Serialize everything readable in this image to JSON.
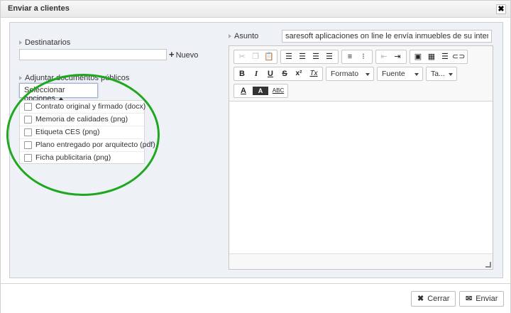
{
  "dialog": {
    "title": "Enviar a clientes",
    "close_glyph": "✖"
  },
  "recipients": {
    "label": "Destinatarios",
    "value": "",
    "new_icon": "+",
    "new_label": "Nuevo"
  },
  "attach": {
    "label": "Adjuntar documentos públicos",
    "select_label": "Seleccionar opciones",
    "options": [
      {
        "label": "Contrato original y firmado (docx)",
        "checked": false
      },
      {
        "label": "Memoria de calidades (png)",
        "checked": false
      },
      {
        "label": "Etiqueta CES (png)",
        "checked": false
      },
      {
        "label": "Plano entregado por arquitecto (pdf)",
        "checked": false
      },
      {
        "label": "Ficha publicitaria (png)",
        "checked": false
      }
    ]
  },
  "subject": {
    "label": "Asunto",
    "value": "saresoft aplicaciones on line le envía inmuebles de su interés"
  },
  "editor": {
    "format_label": "Formato",
    "font_label": "Fuente",
    "size_label": "Ta...",
    "bold": "B",
    "italic": "I",
    "underline": "U",
    "strike": "S",
    "superscript": "x²",
    "clear": "Tx",
    "text_color": "A",
    "bg_color": "A",
    "spellcheck": "ABC"
  },
  "footer": {
    "cancel_icon": "✖",
    "cancel_label": "Cerrar",
    "send_icon": "✉",
    "send_label": "Enviar"
  },
  "colors": {
    "highlight_circle": "#1fa81f",
    "panel_bg": "#eef1f6"
  }
}
